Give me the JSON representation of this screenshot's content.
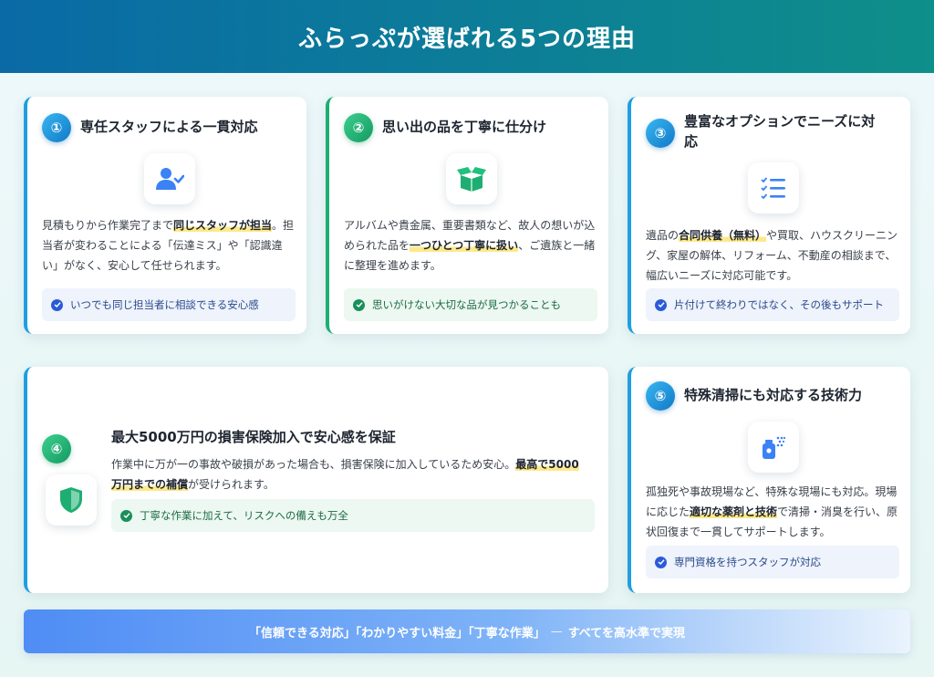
{
  "header": {
    "title": "ふらっぷが選ばれる5つの理由"
  },
  "cards": [
    {
      "num": "①",
      "title": "専任スタッフによる一貫対応",
      "icon": "user-check-icon",
      "text_1": "見積もりから作業完了まで",
      "highlight_1": "同じスタッフが担当",
      "text_2": "。担当者が変わることによる「伝達ミス」や「認識違い」がなく、安心して任せられます。",
      "note": "いつでも同じ担当者に相談できる安心感"
    },
    {
      "num": "②",
      "title": "思い出の品を丁寧に仕分け",
      "icon": "open-box-icon",
      "text_1": "アルバムや貴金属、重要書類など、故人の想いが込められた品を",
      "highlight_1": "一つひとつ丁寧に扱い",
      "text_2": "、ご遺族と一緒に整理を進めます。",
      "note": "思いがけない大切な品が見つかることも"
    },
    {
      "num": "③",
      "title": "豊富なオプションでニーズに対応",
      "icon": "checklist-icon",
      "text_1": "遺品の",
      "highlight_1": "合同供養（無料）",
      "text_2": "や買取、ハウスクリーニング、家屋の解体、リフォーム、不動産の相談まで、幅広いニーズに対応可能です。",
      "note": "片付けて終わりではなく、その後もサポート"
    },
    {
      "num": "④",
      "title": "最大5000万円の損害保険加入で安心感を保証",
      "icon": "shield-icon",
      "text_1": "作業中に万が一の事故や破損があった場合も、損害保険に加入しているため安心。",
      "highlight_1": "最高で5000万円までの補償",
      "text_2": "が受けられます。",
      "note": "丁寧な作業に加えて、リスクへの備えも万全"
    },
    {
      "num": "⑤",
      "title": "特殊清掃にも対応する技術力",
      "icon": "spray-icon",
      "text_1": "孤独死や事故現場など、特殊な現場にも対応。現場に応じた",
      "highlight_1": "適切な薬剤と技術",
      "text_2": "で清掃・消臭を行い、原状回復まで一貫してサポートします。",
      "note": "専門資格を持つスタッフが対応"
    }
  ],
  "footer": {
    "text": "「信頼できる対応」「わかりやすい料金」「丁寧な作業」",
    "dash": "—",
    "tail": "すべてを高水準で実現"
  },
  "colors": {
    "blue_accent": "#1f9fe0",
    "green_accent": "#1fae72",
    "header_start": "#0a6aa6",
    "header_end": "#0e8f8a"
  }
}
